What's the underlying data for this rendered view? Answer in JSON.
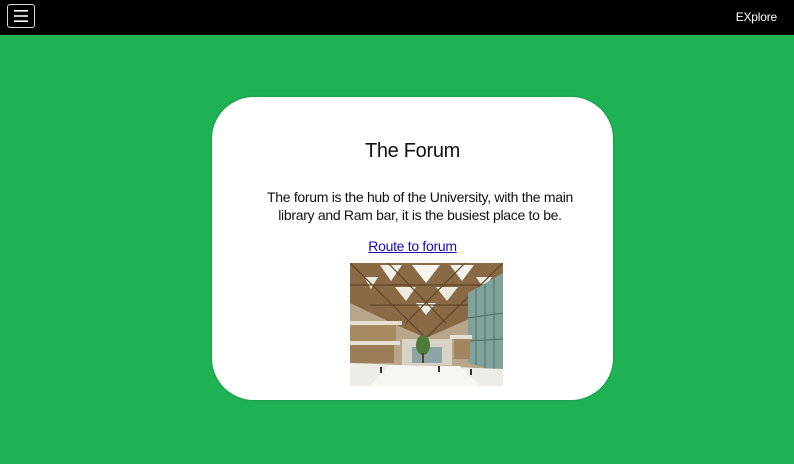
{
  "navbar": {
    "menu_icon": "hamburger-menu-icon",
    "brand_label": "EXplore",
    "background": "#000000"
  },
  "page": {
    "background": "#1fb254"
  },
  "card": {
    "title": "The Forum",
    "description": "The forum is the hub of the University, with the main library and Ram bar, it is the busiest place to be.",
    "link_label": "Route to forum",
    "link_color": "#1a0dab",
    "image_subject": "forum-atrium-photo"
  }
}
